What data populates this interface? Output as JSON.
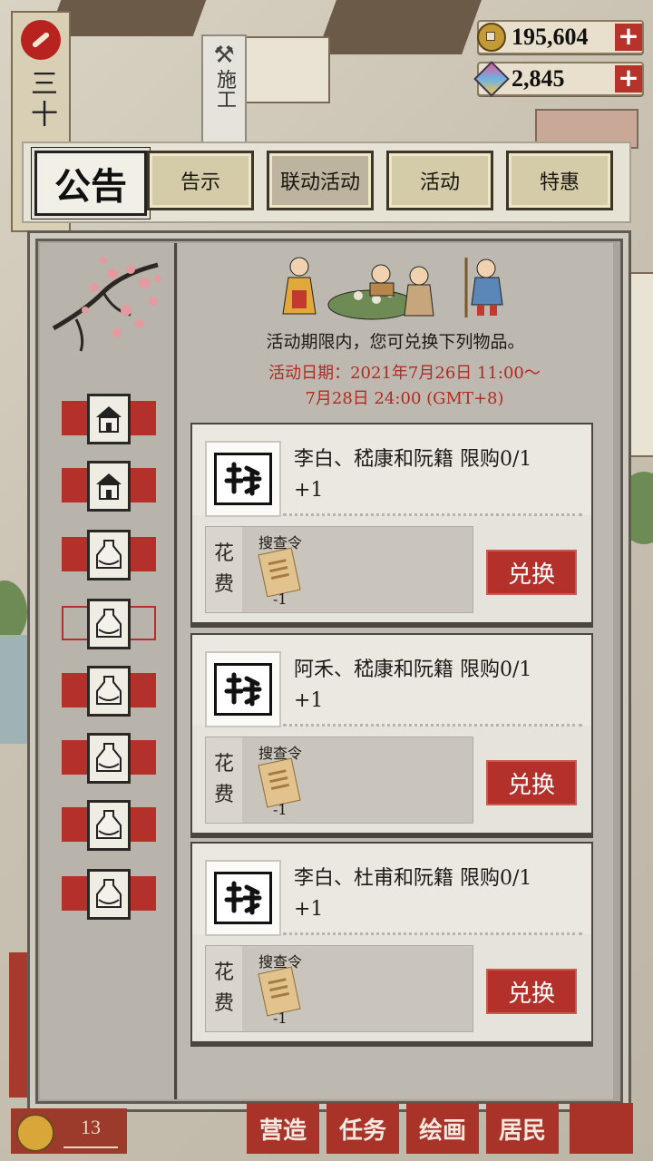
{
  "emblem": {
    "text": "三十"
  },
  "construction_sign": {
    "text": "施工"
  },
  "currencies": {
    "coins": {
      "value": "195,604",
      "icon": "coin-icon"
    },
    "gems": {
      "value": "2,845",
      "icon": "gem-icon"
    },
    "plus_label": "+"
  },
  "tabs": {
    "title": "公告",
    "items": [
      {
        "label": "告示"
      },
      {
        "label": "联动活动"
      },
      {
        "label": "活动"
      },
      {
        "label": "特惠"
      }
    ]
  },
  "event": {
    "notice": "活动期限内，您可兑换下列物品。",
    "date_line1": "活动日期：2021年7月26日 11:00～",
    "date_line2": "7月28日 24:00 (GMT+8)"
  },
  "items": [
    {
      "name": "李白、嵇康和阮籍  限购0/1",
      "count": "+1",
      "cost_label_1": "花",
      "cost_label_2": "费",
      "cost_item": "搜查令",
      "cost_qty": "-1",
      "button": "兑换"
    },
    {
      "name": "阿禾、嵇康和阮籍  限购0/1",
      "count": "+1",
      "cost_label_1": "花",
      "cost_label_2": "费",
      "cost_item": "搜查令",
      "cost_qty": "-1",
      "button": "兑换"
    },
    {
      "name": "李白、杜甫和阮籍  限购0/1",
      "count": "+1",
      "cost_label_1": "花",
      "cost_label_2": "费",
      "cost_item": "搜查令",
      "cost_qty": "-1",
      "button": "兑换"
    }
  ],
  "bottom_nav": {
    "level": "13",
    "buttons": [
      {
        "label": "营造"
      },
      {
        "label": "任务"
      },
      {
        "label": "绘画"
      },
      {
        "label": "居民"
      }
    ]
  }
}
